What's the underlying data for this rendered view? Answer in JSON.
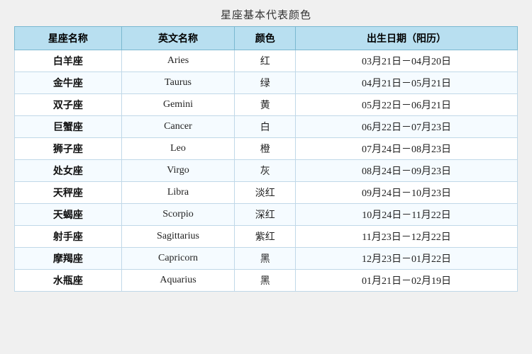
{
  "page": {
    "title": "星座基本代表颜色",
    "headers": [
      "星座名称",
      "英文名称",
      "颜色",
      "出生日期（阳历）"
    ],
    "rows": [
      {
        "chinese": "白羊座",
        "english": "Aries",
        "color": "红",
        "date": "03月21日－04月20日"
      },
      {
        "chinese": "金牛座",
        "english": "Taurus",
        "color": "绿",
        "date": "04月21日－05月21日"
      },
      {
        "chinese": "双子座",
        "english": "Gemini",
        "color": "黄",
        "date": "05月22日－06月21日"
      },
      {
        "chinese": "巨蟹座",
        "english": "Cancer",
        "color": "白",
        "date": "06月22日－07月23日"
      },
      {
        "chinese": "狮子座",
        "english": "Leo",
        "color": "橙",
        "date": "07月24日－08月23日"
      },
      {
        "chinese": "处女座",
        "english": "Virgo",
        "color": "灰",
        "date": "08月24日－09月23日"
      },
      {
        "chinese": "天秤座",
        "english": "Libra",
        "color": "淡红",
        "date": "09月24日－10月23日"
      },
      {
        "chinese": "天蝎座",
        "english": "Scorpio",
        "color": "深红",
        "date": "10月24日－11月22日"
      },
      {
        "chinese": "射手座",
        "english": "Sagittarius",
        "color": "紫红",
        "date": "11月23日－12月22日"
      },
      {
        "chinese": "摩羯座",
        "english": "Capricorn",
        "color": "黑",
        "date": "12月23日－01月22日"
      },
      {
        "chinese": "水瓶座",
        "english": "Aquarius",
        "color": "黑",
        "date": "01月21日－02月19日"
      }
    ]
  }
}
